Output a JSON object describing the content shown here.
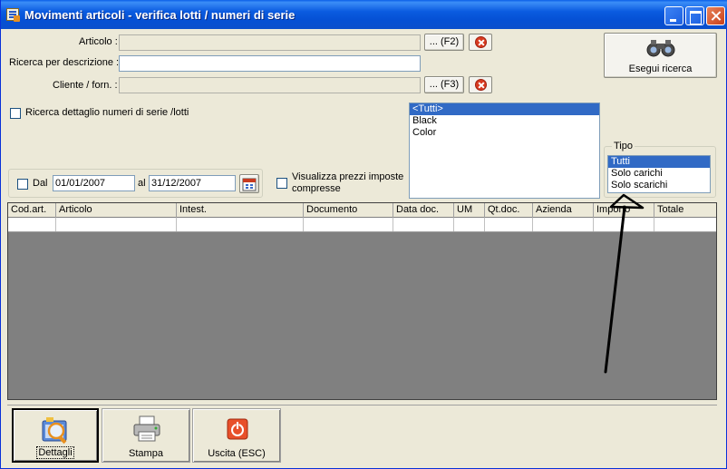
{
  "window": {
    "title": "Movimenti articoli - verifica lotti / numeri di serie",
    "icon": "app-list-icon"
  },
  "form": {
    "articolo_label": "Articolo :",
    "articolo_value": "",
    "articolo_btn": "... (F2)",
    "descrizione_label": "Ricerca per descrizione :",
    "descrizione_value": "",
    "cliente_label": "Cliente / forn. :",
    "cliente_value": "",
    "cliente_btn": "... (F3)",
    "dettaglio_label": "Ricerca dettaglio numeri di serie /lotti",
    "dal_label": "Dal",
    "dal_value": "01/01/2007",
    "al_label": "al",
    "al_value": "31/12/2007",
    "prezzi_label_1": "Visualizza prezzi imposte",
    "prezzi_label_2": "compresse",
    "esegui_label": "Esegui ricerca"
  },
  "colors_list": {
    "items": [
      "<Tutti>",
      "Black",
      "Color"
    ],
    "selected": 0
  },
  "tipo": {
    "title": "Tipo",
    "items": [
      "Tutti",
      "Solo carichi",
      "Solo scarichi"
    ],
    "selected": 0
  },
  "grid": {
    "columns": [
      "Cod.art.",
      "Articolo",
      "Intest.",
      "Documento",
      "Data doc.",
      "UM",
      "Qt.doc.",
      "Azienda",
      "Importo",
      "Totale"
    ]
  },
  "toolbar": {
    "dettagli": "Dettagli",
    "stampa": "Stampa",
    "uscita": "Uscita (ESC)"
  },
  "colors": {
    "titlebar": "#0a5be0",
    "selection": "#316ac5",
    "grid_bg": "#808080"
  }
}
